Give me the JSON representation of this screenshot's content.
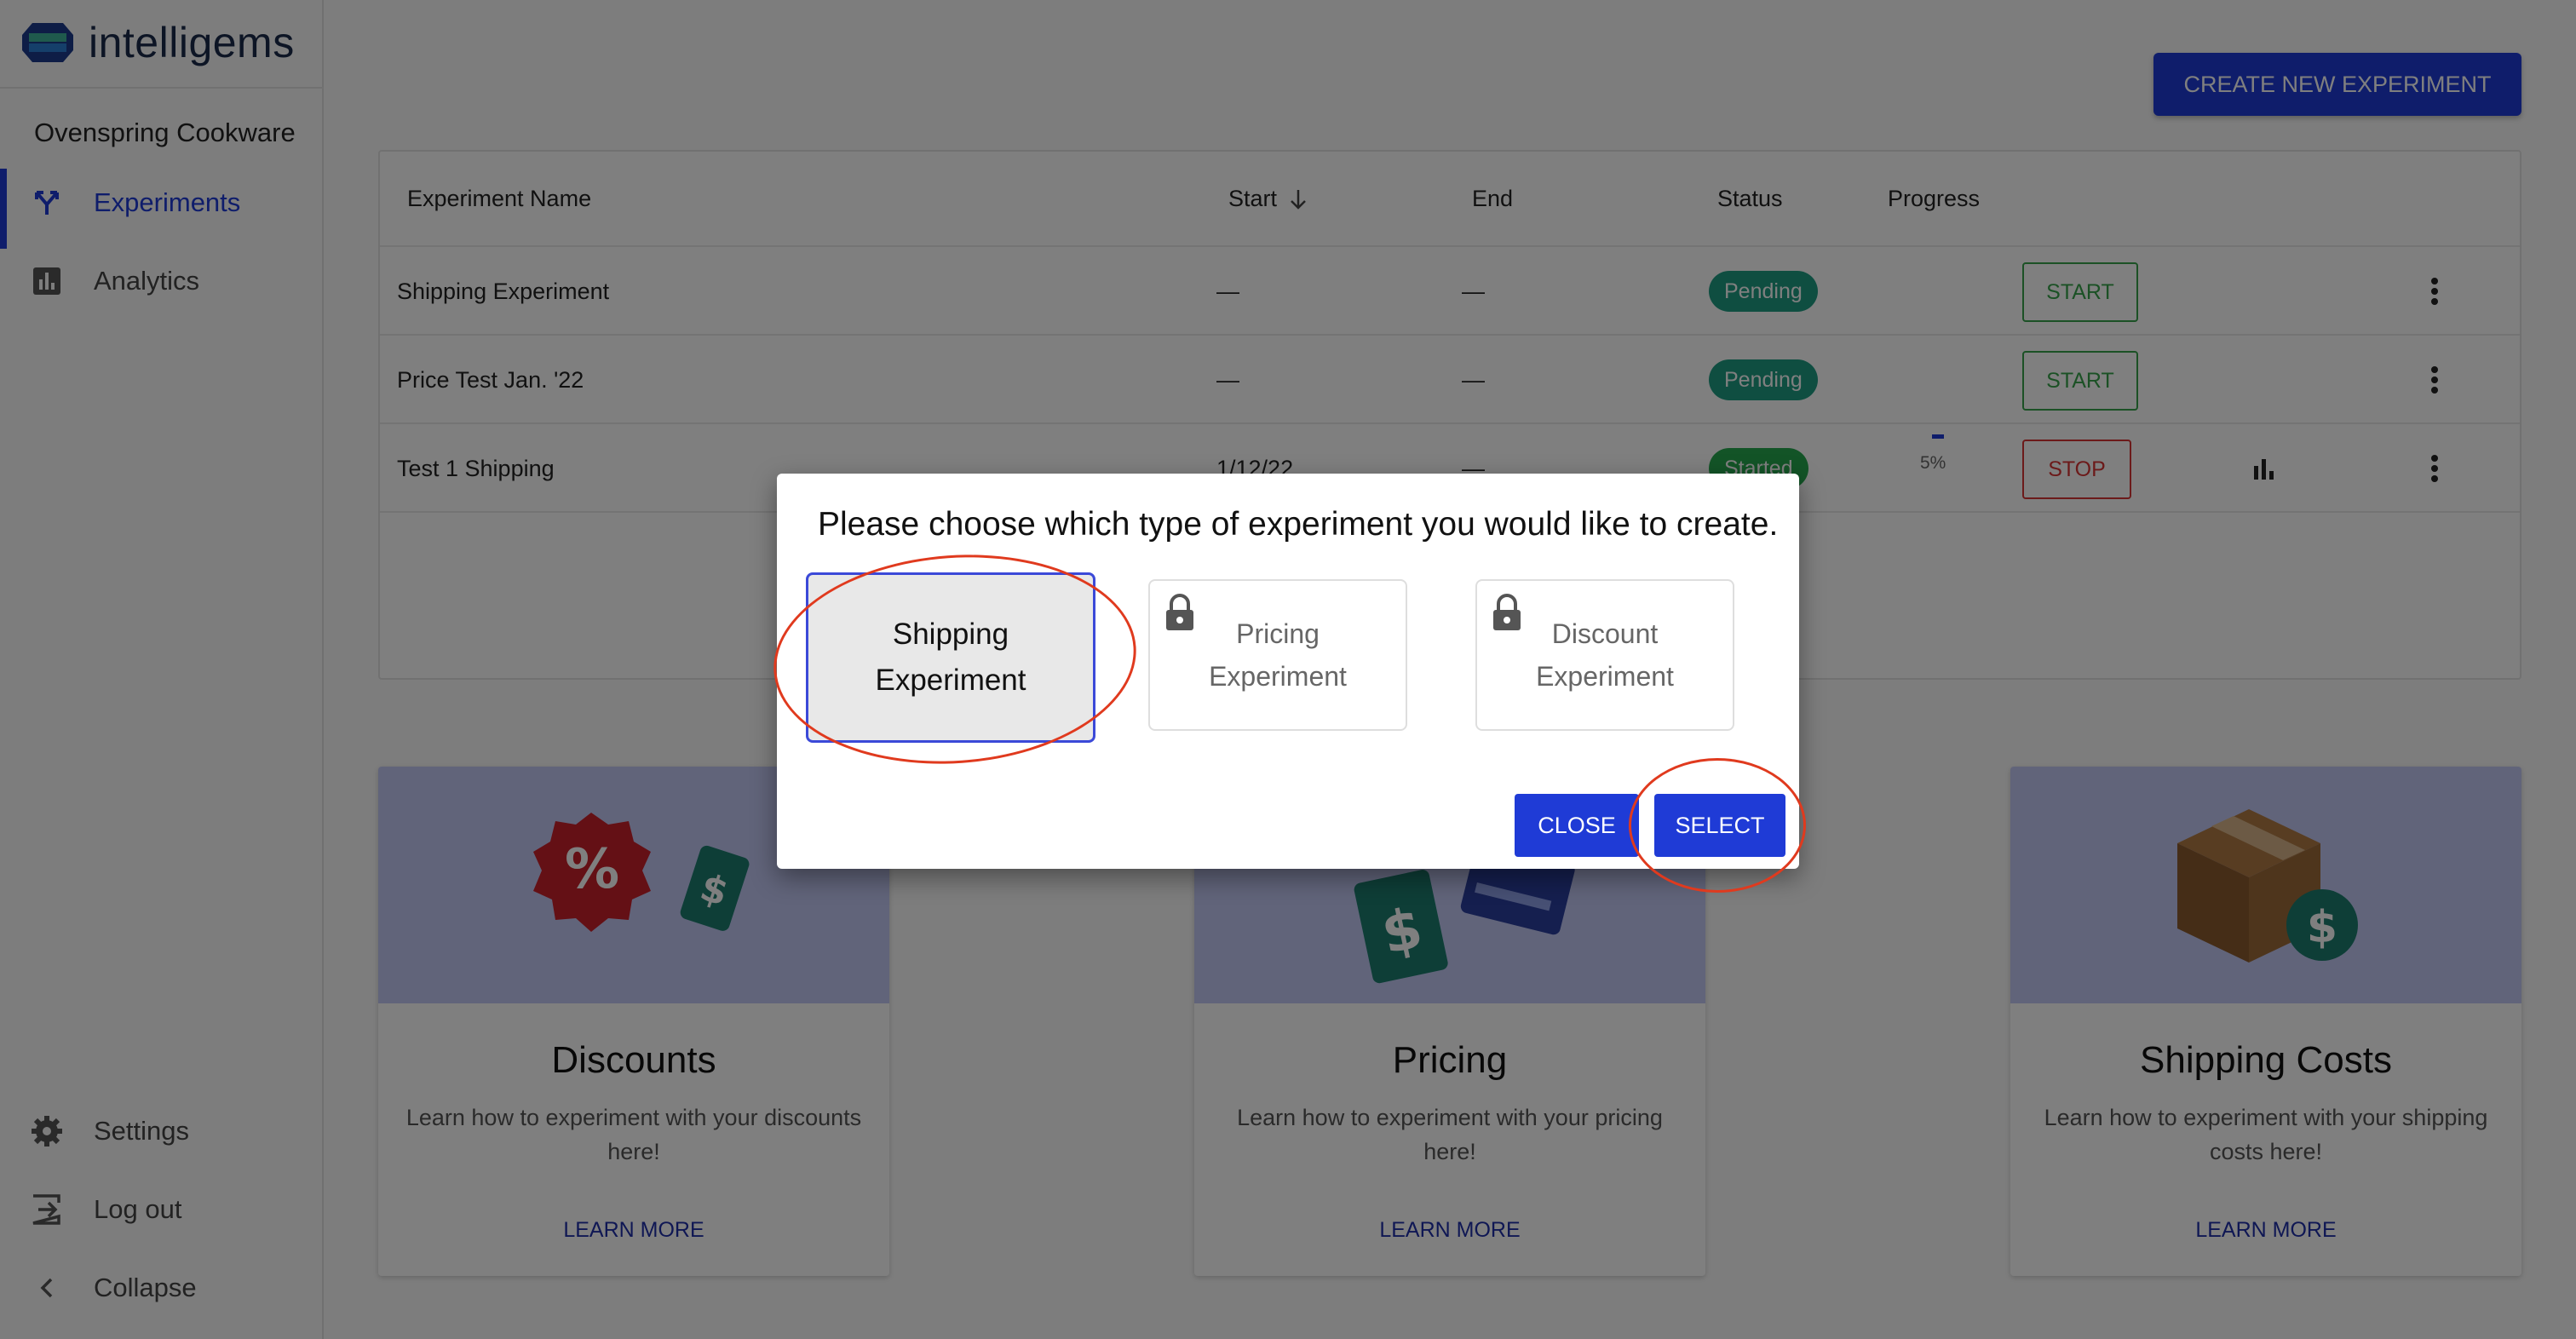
{
  "app": {
    "brand": "intelligems",
    "store_name": "Ovenspring Cookware"
  },
  "sidebar": {
    "nav": [
      {
        "label": "Experiments",
        "icon": "experiments-icon",
        "active": true
      },
      {
        "label": "Analytics",
        "icon": "bar-chart-icon",
        "active": false
      }
    ],
    "bottom": [
      {
        "label": "Settings",
        "icon": "gear-icon"
      },
      {
        "label": "Log out",
        "icon": "logout-icon"
      },
      {
        "label": "Collapse",
        "icon": "chevron-left-icon"
      }
    ]
  },
  "toolbar": {
    "create_label": "CREATE NEW EXPERIMENT"
  },
  "table": {
    "headers": [
      "Experiment Name",
      "Start",
      "End",
      "Status",
      "Progress"
    ],
    "rows": [
      {
        "name": "Shipping Experiment",
        "start": "—",
        "end": "—",
        "status": "Pending",
        "action": "START"
      },
      {
        "name": "Price Test Jan. '22",
        "start": "—",
        "end": "—",
        "status": "Pending",
        "action": "START"
      },
      {
        "name": "Test 1 Shipping",
        "start": "1/12/22",
        "end": "—",
        "status": "Started",
        "progress": "5%",
        "action": "STOP"
      }
    ]
  },
  "learn_cards": [
    {
      "title": "Discounts",
      "desc": "Learn how to experiment with your discounts here!",
      "link": "LEARN MORE"
    },
    {
      "title": "Pricing",
      "desc": "Learn how to experiment with your pricing here!",
      "link": "LEARN MORE"
    },
    {
      "title": "Shipping Costs",
      "desc": "Learn how to experiment with your shipping costs here!",
      "link": "LEARN MORE"
    }
  ],
  "modal": {
    "title": "Please choose which type of experiment you would like to create.",
    "options": [
      {
        "label": "Shipping Experiment",
        "locked": false,
        "selected": true
      },
      {
        "label": "Pricing Experiment",
        "locked": true,
        "selected": false
      },
      {
        "label": "Discount Experiment",
        "locked": true,
        "selected": false
      }
    ],
    "close_label": "CLOSE",
    "select_label": "SELECT"
  },
  "colors": {
    "primary": "#1f3bd6",
    "pending": "#1e9c83",
    "started": "#27a94f",
    "stop": "#d83434",
    "annotation": "#e03a1e"
  }
}
